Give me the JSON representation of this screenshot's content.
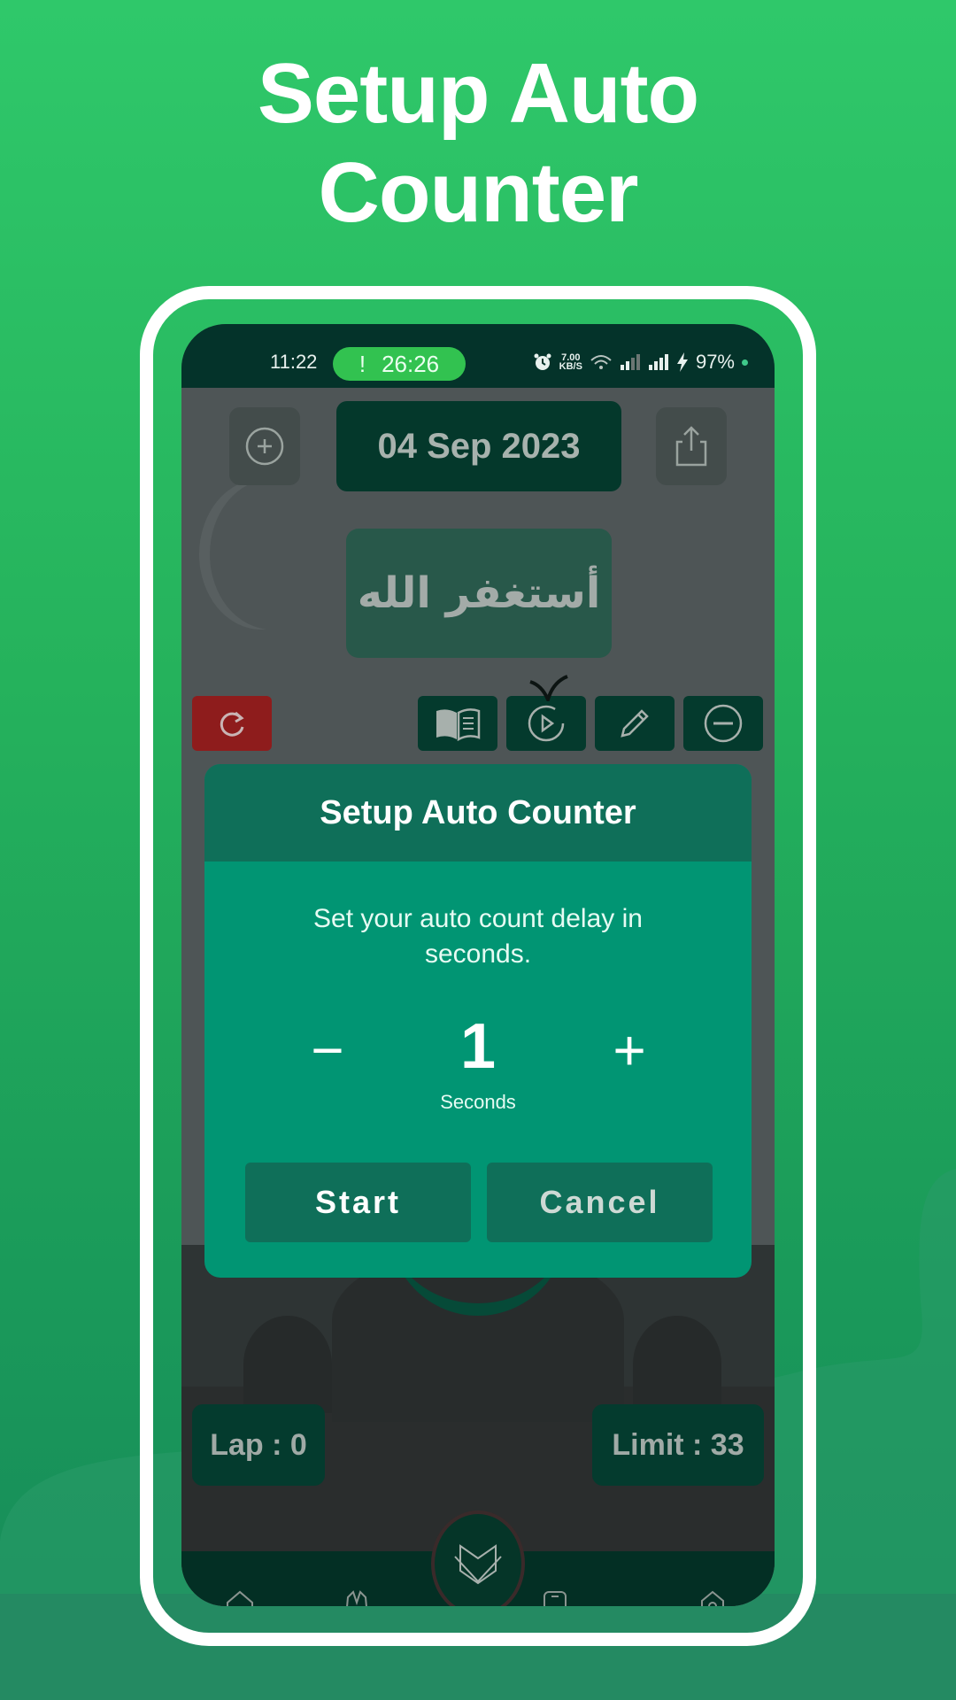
{
  "promo": {
    "headline_line1": "Setup Auto",
    "headline_line2": "Counter"
  },
  "statusbar": {
    "time": "11:22",
    "call_timer": "26:26",
    "call_indicator": "!",
    "net_speed_value": "7.00",
    "net_speed_unit": "KB/S",
    "battery": "97%",
    "icons": [
      "alarm-icon",
      "wifi-icon",
      "signal-icon",
      "signal-icon",
      "charging-icon"
    ]
  },
  "app": {
    "date": "04 Sep 2023",
    "dhikr_text": "أستغفر الله",
    "toolbar_icons": [
      "reset-icon",
      "book-icon",
      "play-icon",
      "pencil-icon",
      "minus-circle-icon"
    ],
    "lap_label": "Lap : 0",
    "limit_label": "Limit : 33",
    "bottom_nav": [
      "home-icon",
      "prayer-hands-icon",
      "quran-icon",
      "phone-icon",
      "settings-icon"
    ]
  },
  "dialog": {
    "title": "Setup Auto Counter",
    "message": "Set your auto count delay in seconds.",
    "decrement_label": "−",
    "increment_label": "+",
    "value": "1",
    "unit": "Seconds",
    "start_label": "Start",
    "cancel_label": "Cancel"
  },
  "colors": {
    "background_green": "#2fc86a",
    "dialog_body": "#019573",
    "dialog_header": "#0f6f59",
    "statusbar": "#04332a",
    "reset_red": "#8e1c1c"
  }
}
